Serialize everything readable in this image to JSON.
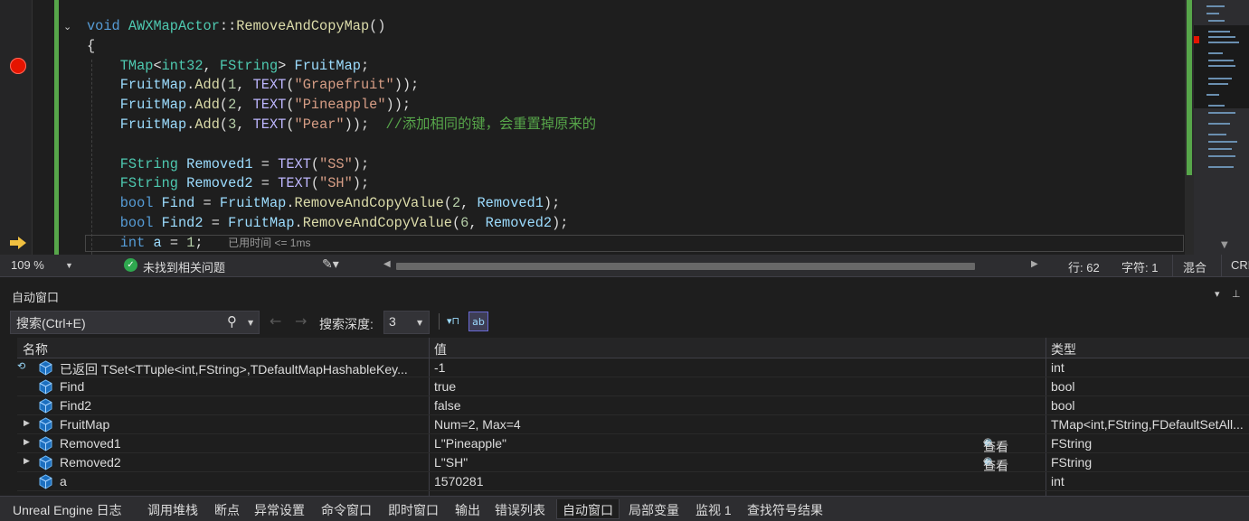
{
  "editor": {
    "code_lines": [
      [
        {
          "t": "void ",
          "c": "kw"
        },
        {
          "t": "AWXMapActor",
          "c": "ty"
        },
        {
          "t": "::",
          "c": ""
        },
        {
          "t": "RemoveAndCopyMap",
          "c": "fn"
        },
        {
          "t": "()",
          "c": ""
        }
      ],
      [
        {
          "t": "{",
          "c": ""
        }
      ],
      [
        {
          "t": "    ",
          "c": ""
        },
        {
          "t": "TMap",
          "c": "ty"
        },
        {
          "t": "<",
          "c": ""
        },
        {
          "t": "int32",
          "c": "ty"
        },
        {
          "t": ", ",
          "c": ""
        },
        {
          "t": "FString",
          "c": "ty"
        },
        {
          "t": "> ",
          "c": ""
        },
        {
          "t": "FruitMap",
          "c": "va"
        },
        {
          "t": ";",
          "c": ""
        }
      ],
      [
        {
          "t": "    ",
          "c": ""
        },
        {
          "t": "FruitMap",
          "c": "va"
        },
        {
          "t": ".",
          "c": ""
        },
        {
          "t": "Add",
          "c": "fn"
        },
        {
          "t": "(",
          "c": ""
        },
        {
          "t": "1",
          "c": "nu"
        },
        {
          "t": ", ",
          "c": ""
        },
        {
          "t": "TEXT",
          "c": "mac"
        },
        {
          "t": "(",
          "c": ""
        },
        {
          "t": "\"Grapefruit\"",
          "c": "st"
        },
        {
          "t": "));",
          "c": ""
        }
      ],
      [
        {
          "t": "    ",
          "c": ""
        },
        {
          "t": "FruitMap",
          "c": "va"
        },
        {
          "t": ".",
          "c": ""
        },
        {
          "t": "Add",
          "c": "fn"
        },
        {
          "t": "(",
          "c": ""
        },
        {
          "t": "2",
          "c": "nu"
        },
        {
          "t": ", ",
          "c": ""
        },
        {
          "t": "TEXT",
          "c": "mac"
        },
        {
          "t": "(",
          "c": ""
        },
        {
          "t": "\"Pineapple\"",
          "c": "st"
        },
        {
          "t": "));",
          "c": ""
        }
      ],
      [
        {
          "t": "    ",
          "c": ""
        },
        {
          "t": "FruitMap",
          "c": "va"
        },
        {
          "t": ".",
          "c": ""
        },
        {
          "t": "Add",
          "c": "fn"
        },
        {
          "t": "(",
          "c": ""
        },
        {
          "t": "3",
          "c": "nu"
        },
        {
          "t": ", ",
          "c": ""
        },
        {
          "t": "TEXT",
          "c": "mac"
        },
        {
          "t": "(",
          "c": ""
        },
        {
          "t": "\"Pear\"",
          "c": "st"
        },
        {
          "t": "));  ",
          "c": ""
        },
        {
          "t": "//添加相同的键，会重置掉原来的",
          "c": "cm"
        }
      ],
      [
        {
          "t": "",
          "c": ""
        }
      ],
      [
        {
          "t": "    ",
          "c": ""
        },
        {
          "t": "FString",
          "c": "ty"
        },
        {
          "t": " ",
          "c": ""
        },
        {
          "t": "Removed1",
          "c": "va"
        },
        {
          "t": " = ",
          "c": ""
        },
        {
          "t": "TEXT",
          "c": "mac"
        },
        {
          "t": "(",
          "c": ""
        },
        {
          "t": "\"SS\"",
          "c": "st"
        },
        {
          "t": ");",
          "c": ""
        }
      ],
      [
        {
          "t": "    ",
          "c": ""
        },
        {
          "t": "FString",
          "c": "ty"
        },
        {
          "t": " ",
          "c": ""
        },
        {
          "t": "Removed2",
          "c": "va"
        },
        {
          "t": " = ",
          "c": ""
        },
        {
          "t": "TEXT",
          "c": "mac"
        },
        {
          "t": "(",
          "c": ""
        },
        {
          "t": "\"SH\"",
          "c": "st"
        },
        {
          "t": ");",
          "c": ""
        }
      ],
      [
        {
          "t": "    ",
          "c": ""
        },
        {
          "t": "bool",
          "c": "kw"
        },
        {
          "t": " ",
          "c": ""
        },
        {
          "t": "Find",
          "c": "va"
        },
        {
          "t": " = ",
          "c": ""
        },
        {
          "t": "FruitMap",
          "c": "va"
        },
        {
          "t": ".",
          "c": ""
        },
        {
          "t": "RemoveAndCopyValue",
          "c": "fn"
        },
        {
          "t": "(",
          "c": ""
        },
        {
          "t": "2",
          "c": "nu"
        },
        {
          "t": ", ",
          "c": ""
        },
        {
          "t": "Removed1",
          "c": "va"
        },
        {
          "t": ");",
          "c": ""
        }
      ],
      [
        {
          "t": "    ",
          "c": ""
        },
        {
          "t": "bool",
          "c": "kw"
        },
        {
          "t": " ",
          "c": ""
        },
        {
          "t": "Find2",
          "c": "va"
        },
        {
          "t": " = ",
          "c": ""
        },
        {
          "t": "FruitMap",
          "c": "va"
        },
        {
          "t": ".",
          "c": ""
        },
        {
          "t": "RemoveAndCopyValue",
          "c": "fn"
        },
        {
          "t": "(",
          "c": ""
        },
        {
          "t": "6",
          "c": "nu"
        },
        {
          "t": ", ",
          "c": ""
        },
        {
          "t": "Removed2",
          "c": "va"
        },
        {
          "t": ");",
          "c": ""
        }
      ],
      [
        {
          "t": "    ",
          "c": ""
        },
        {
          "t": "int",
          "c": "kw"
        },
        {
          "t": " ",
          "c": ""
        },
        {
          "t": "a",
          "c": "va"
        },
        {
          "t": " = ",
          "c": ""
        },
        {
          "t": "1",
          "c": "nu"
        },
        {
          "t": ";",
          "c": ""
        }
      ]
    ],
    "elapsed_hint": "已用时间 <= 1ms"
  },
  "statusbar": {
    "zoom": "109 %",
    "issues": "未找到相关问题",
    "line": "行: 62",
    "column": "字符: 1",
    "whitespace": "混合",
    "line_ending": "CRLF"
  },
  "autos": {
    "title": "自动窗口",
    "search_placeholder": "搜索(Ctrl+E)",
    "depth_label": "搜索深度:",
    "depth_value": "3",
    "columns": {
      "name": "名称",
      "value": "值",
      "type": "类型"
    },
    "rows": [
      {
        "name": "已返回 TSet<TTuple<int,FString>,TDefaultMapHashableKey...",
        "value": "-1",
        "type": "int",
        "expandable": false,
        "returned": true,
        "viewer": ""
      },
      {
        "name": "Find",
        "value": "true",
        "type": "bool",
        "expandable": false,
        "returned": false,
        "viewer": ""
      },
      {
        "name": "Find2",
        "value": "false",
        "type": "bool",
        "expandable": false,
        "returned": false,
        "viewer": ""
      },
      {
        "name": "FruitMap",
        "value": "Num=2, Max=4",
        "type": "TMap<int,FString,FDefaultSetAll...",
        "expandable": true,
        "returned": false,
        "viewer": ""
      },
      {
        "name": "Removed1",
        "value": "L\"Pineapple\"",
        "type": "FString",
        "expandable": true,
        "returned": false,
        "viewer": "查看"
      },
      {
        "name": "Removed2",
        "value": "L\"SH\"",
        "type": "FString",
        "expandable": true,
        "returned": false,
        "viewer": "查看"
      },
      {
        "name": "a",
        "value": "1570281",
        "type": "int",
        "expandable": false,
        "returned": false,
        "viewer": ""
      }
    ]
  },
  "bottom_tabs": [
    "Unreal Engine 日志",
    "调用堆栈",
    "断点",
    "异常设置",
    "命令窗口",
    "即时窗口",
    "输出",
    "错误列表",
    "自动窗口",
    "局部变量",
    "监视 1",
    "查找符号结果"
  ],
  "active_tab": "自动窗口",
  "colors": {
    "accent": "#007acc",
    "breakpoint": "#e51400",
    "change_bar": "#57a64a",
    "keyword": "#569cd6",
    "type": "#4ec9b0",
    "string": "#d69d85",
    "comment": "#57a64a"
  }
}
